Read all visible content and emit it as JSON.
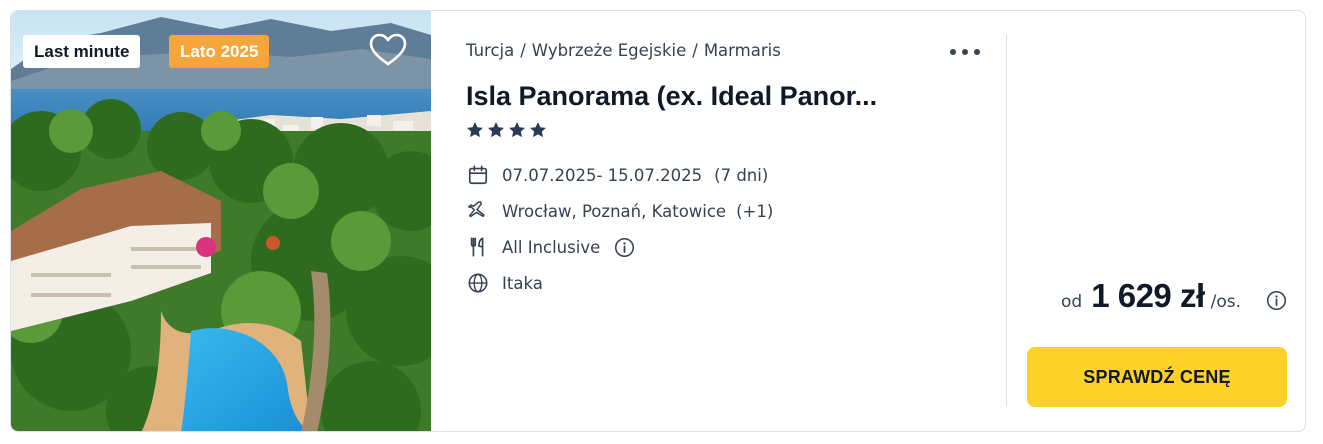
{
  "badges": {
    "last_minute": "Last minute",
    "season": "Lato 2025"
  },
  "breadcrumb": [
    "Turcja",
    "Wybrzeże Egejskie",
    "Marmaris"
  ],
  "breadcrumb_separator": "/",
  "hotel": {
    "name": "Isla Panorama (ex. Ideal Panor...",
    "star_rating": 4
  },
  "details": {
    "dates": "07.07.2025- 15.07.2025",
    "duration": "(7 dni)",
    "departure": "Wrocław, Poznań, Katowice",
    "departure_more": "(+1)",
    "board": "All Inclusive",
    "operator": "Itaka"
  },
  "price": {
    "prefix": "od",
    "amount": "1 629 zł",
    "suffix": "/os."
  },
  "cta_label": "SPRAWDŹ CENĘ",
  "icons": {
    "favorite": "heart-icon",
    "more": "more-dots-icon",
    "dates": "calendar-icon",
    "flights": "plane-icon",
    "board": "cutlery-icon",
    "operator": "globe-icon",
    "info": "info-icon"
  },
  "colors": {
    "cta": "#fcd12a",
    "season_badge": "#f6a53b",
    "stars": "#2b3a55"
  }
}
